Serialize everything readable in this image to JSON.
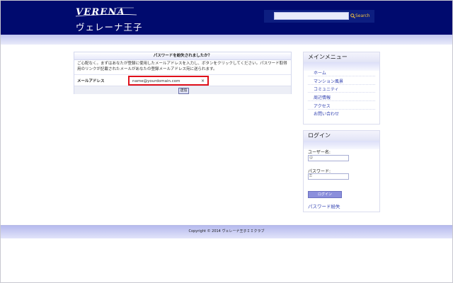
{
  "header": {
    "logo_wordmark": "VERENA",
    "logo_subtitle": "ヴェレーナ王子",
    "search": {
      "placeholder": "",
      "button_label": "Search",
      "icon": "search-icon"
    }
  },
  "main": {
    "title": "パスワードを紛失されましたか？",
    "description": "ご心配なく。まずはあなたが登録に使用したメールアドレスを入力し、ボタンをクリックしてください。パスワード取得用のリンクが記載されたメールがあなたの登録メールアドレス宛に送られます。",
    "email_label": "メールアドレス",
    "email_value": "name@yourdomain.com",
    "clear_label": "×",
    "submit_label": "送信"
  },
  "sidebar": {
    "menu": {
      "title": "メインメニュー",
      "items": [
        {
          "label": "ホーム"
        },
        {
          "label": "マンション風景"
        },
        {
          "label": "コミュニティ"
        },
        {
          "label": "周辺情報"
        },
        {
          "label": "アクセス"
        },
        {
          "label": "お問い合わせ"
        }
      ]
    },
    "login": {
      "title": "ログイン",
      "username_label": "ユーザー名:",
      "username_value": "",
      "password_label": "パスワード:",
      "password_value": "",
      "login_button": "ログイン",
      "lost_password_link": "パスワード紛失"
    }
  },
  "footer": {
    "copyright": "Copyright © 2014 ヴェレーナ王子ＩＩクラブ"
  },
  "colors": {
    "header_bg": "#000a6e",
    "accent": "#8b8fdc",
    "link": "#3040b0",
    "highlight": "#e0101a"
  }
}
